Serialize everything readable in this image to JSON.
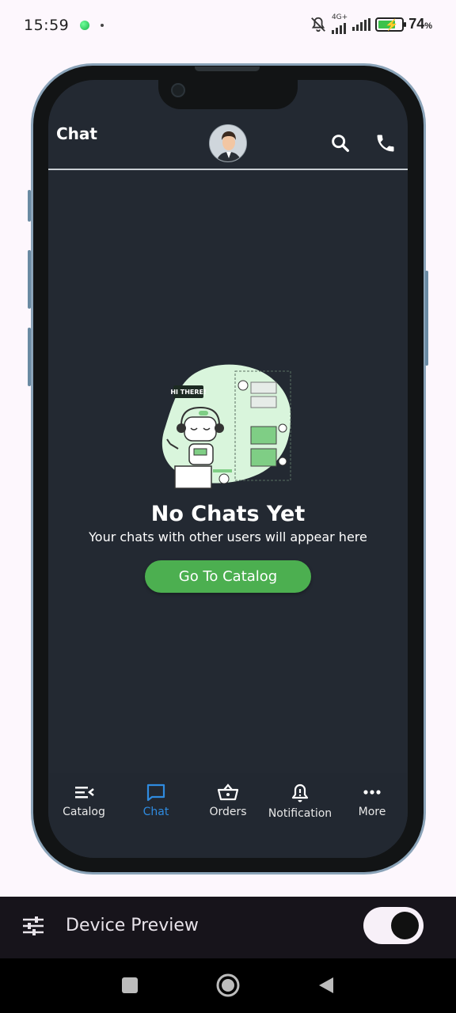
{
  "status_bar": {
    "time": "15:59",
    "network_label": "4G+",
    "battery_percent": "74",
    "battery_level": 0.74,
    "battery_pct_sign": "%"
  },
  "app": {
    "title": "Chat",
    "header_icons": [
      "search-icon",
      "phone-icon"
    ]
  },
  "empty_state": {
    "bubble_text": "HI THERE!",
    "title": "No Chats Yet",
    "subtitle": "Your chats with other users will appear here",
    "button_label": "Go To Catalog"
  },
  "bottom_nav": {
    "items": [
      {
        "label": "Catalog",
        "icon": "catalog-icon",
        "active": false
      },
      {
        "label": "Chat",
        "icon": "chat-icon",
        "active": true
      },
      {
        "label": "Orders",
        "icon": "basket-icon",
        "active": false
      },
      {
        "label": "Notification",
        "icon": "bell-icon",
        "active": false
      },
      {
        "label": "More",
        "icon": "more-icon",
        "active": false
      }
    ]
  },
  "device_preview": {
    "label": "Device Preview",
    "toggle_on": true
  },
  "colors": {
    "screen_bg": "#232932",
    "accent_green": "#4caf50",
    "active_tab": "#2f8be0",
    "frame": "#8aa3b8"
  }
}
